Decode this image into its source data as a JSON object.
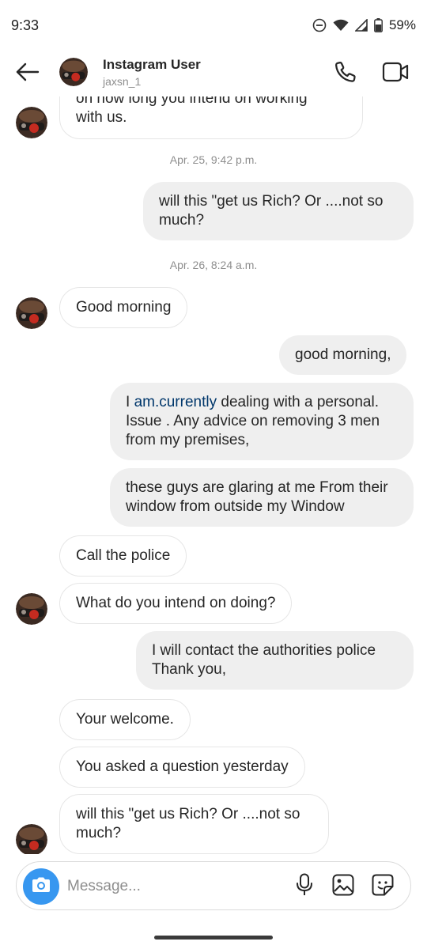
{
  "status_bar": {
    "time": "9:33",
    "battery": "59%",
    "icons": [
      "do-not-disturb-icon",
      "wifi-icon",
      "signal-icon",
      "battery-icon"
    ]
  },
  "header": {
    "title": "Instagram User",
    "username": "jaxsn_1",
    "icons": [
      "back-arrow-icon",
      "phone-icon",
      "video-camera-icon"
    ]
  },
  "thread": {
    "partial_message": {
      "line1": "on how long you intend on working",
      "line2": "with us."
    },
    "timestamp_1": "Apr. 25, 9:42 p.m.",
    "msg_rich_out": "will this \"get us Rich? Or ....not so much?",
    "timestamp_2": "Apr. 26, 8:24 a.m.",
    "msg_good_morning_in": "Good morning",
    "msg_good_morning_out": "good morning,",
    "msg_personal": {
      "prefix": "I ",
      "link": "am.currently",
      "suffix": " dealing with a personal. Issue . Any advice on removing 3 men from my premises,"
    },
    "msg_glaring": "these guys are glaring at me From their window from outside my Window",
    "msg_call_police": "Call the police",
    "msg_intend": "What do you intend on doing?",
    "msg_authorities": "I will contact the authorities police Thank you,",
    "msg_welcome": "Your welcome.",
    "msg_question": "You asked a question yesterday",
    "msg_rich_in": "will this \"get us Rich? Or ....not so much?"
  },
  "composer": {
    "placeholder": "Message...",
    "icons": [
      "camera-icon",
      "microphone-icon",
      "gallery-icon",
      "sticker-icon"
    ]
  },
  "colors": {
    "accent_blue": "#3797f0",
    "link_blue": "#00376b",
    "outgoing_bubble": "#efefef",
    "timestamp_gray": "#8e8e8e"
  }
}
